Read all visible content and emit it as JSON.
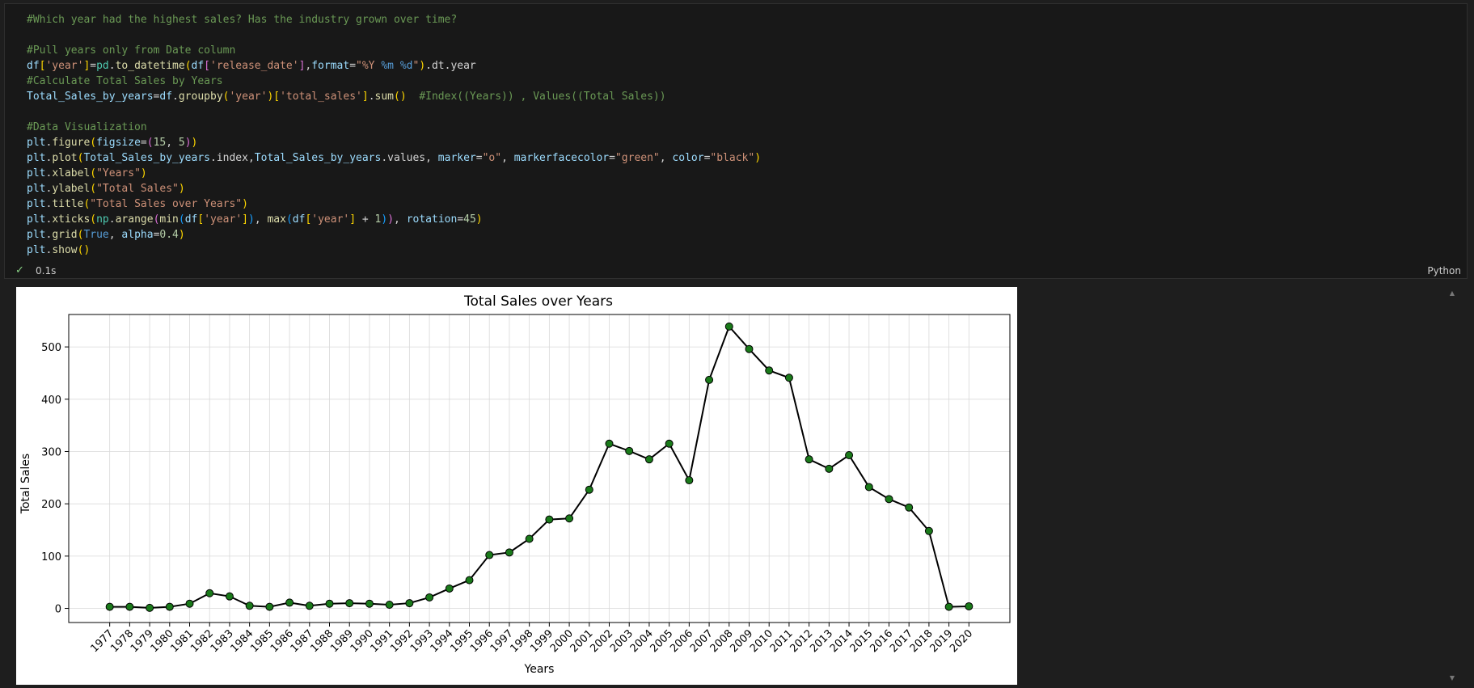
{
  "code_lines": [
    [
      [
        "c-com",
        "#Which year had the highest sales? Has the industry grown over time?"
      ]
    ],
    [],
    [
      [
        "c-com",
        "#Pull years only from Date column"
      ]
    ],
    [
      [
        "c-var",
        "df"
      ],
      [
        "c-br1",
        "["
      ],
      [
        "c-str",
        "'year'"
      ],
      [
        "c-br1",
        "]"
      ],
      [
        "",
        "="
      ],
      [
        "c-mod",
        "pd"
      ],
      [
        "",
        ".",
        ""
      ],
      [
        "c-fn",
        "to_datetime"
      ],
      [
        "c-br1",
        "("
      ],
      [
        "c-var",
        "df"
      ],
      [
        "c-br2",
        "["
      ],
      [
        "c-str",
        "'release_date'"
      ],
      [
        "c-br2",
        "]"
      ],
      [
        "",
        ","
      ],
      [
        "c-var",
        "format"
      ],
      [
        "",
        "="
      ],
      [
        "c-str",
        "\"%Y "
      ],
      [
        "c-kw",
        "%m"
      ],
      [
        "c-str",
        " "
      ],
      [
        "c-kw",
        "%d"
      ],
      [
        "c-str",
        "\""
      ],
      [
        "c-br1",
        ")"
      ],
      [
        "",
        ".dt.year"
      ]
    ],
    [
      [
        "c-com",
        "#Calculate Total Sales by Years"
      ]
    ],
    [
      [
        "c-var",
        "Total_Sales_by_years"
      ],
      [
        "",
        "="
      ],
      [
        "c-var",
        "df"
      ],
      [
        "",
        ".",
        ""
      ],
      [
        "c-fn",
        "groupby"
      ],
      [
        "c-br1",
        "("
      ],
      [
        "c-str",
        "'year'"
      ],
      [
        "c-br1",
        ")"
      ],
      [
        "c-br1",
        "["
      ],
      [
        "c-str",
        "'total_sales'"
      ],
      [
        "c-br1",
        "]"
      ],
      [
        "",
        ".",
        ""
      ],
      [
        "c-fn",
        "sum"
      ],
      [
        "c-br1",
        "()"
      ],
      [
        "",
        "  "
      ],
      [
        "c-com",
        "#Index((Years)) , Values((Total Sales))"
      ]
    ],
    [],
    [
      [
        "c-com",
        "#Data Visualization"
      ]
    ],
    [
      [
        "c-var",
        "plt"
      ],
      [
        "",
        ".",
        ""
      ],
      [
        "c-fn",
        "figure"
      ],
      [
        "c-br1",
        "("
      ],
      [
        "c-var",
        "figsize"
      ],
      [
        "",
        "="
      ],
      [
        "c-br2",
        "("
      ],
      [
        "c-num",
        "15"
      ],
      [
        "",
        ", "
      ],
      [
        "c-num",
        "5"
      ],
      [
        "c-br2",
        ")"
      ],
      [
        "c-br1",
        ")"
      ]
    ],
    [
      [
        "c-var",
        "plt"
      ],
      [
        "",
        ".",
        ""
      ],
      [
        "c-fn",
        "plot"
      ],
      [
        "c-br1",
        "("
      ],
      [
        "c-var",
        "Total_Sales_by_years"
      ],
      [
        "",
        ".index,"
      ],
      [
        "c-var",
        "Total_Sales_by_years"
      ],
      [
        "",
        ".values, "
      ],
      [
        "c-var",
        "marker"
      ],
      [
        "",
        "="
      ],
      [
        "c-str",
        "\"o\""
      ],
      [
        "",
        ", "
      ],
      [
        "c-var",
        "markerfacecolor"
      ],
      [
        "",
        "="
      ],
      [
        "c-str",
        "\"green\""
      ],
      [
        "",
        ", "
      ],
      [
        "c-var",
        "color"
      ],
      [
        "",
        "="
      ],
      [
        "c-str",
        "\"black\""
      ],
      [
        "c-br1",
        ")"
      ]
    ],
    [
      [
        "c-var",
        "plt"
      ],
      [
        "",
        ".",
        ""
      ],
      [
        "c-fn",
        "xlabel"
      ],
      [
        "c-br1",
        "("
      ],
      [
        "c-str",
        "\"Years\""
      ],
      [
        "c-br1",
        ")"
      ]
    ],
    [
      [
        "c-var",
        "plt"
      ],
      [
        "",
        ".",
        ""
      ],
      [
        "c-fn",
        "ylabel"
      ],
      [
        "c-br1",
        "("
      ],
      [
        "c-str",
        "\"Total Sales\""
      ],
      [
        "c-br1",
        ")"
      ]
    ],
    [
      [
        "c-var",
        "plt"
      ],
      [
        "",
        ".",
        ""
      ],
      [
        "c-fn",
        "title"
      ],
      [
        "c-br1",
        "("
      ],
      [
        "c-str",
        "\"Total Sales over Years\""
      ],
      [
        "c-br1",
        ")"
      ]
    ],
    [
      [
        "c-var",
        "plt"
      ],
      [
        "",
        ".",
        ""
      ],
      [
        "c-fn",
        "xticks"
      ],
      [
        "c-br1",
        "("
      ],
      [
        "c-mod",
        "np"
      ],
      [
        "",
        ".",
        ""
      ],
      [
        "c-fn",
        "arange"
      ],
      [
        "c-br2",
        "("
      ],
      [
        "c-fn",
        "min"
      ],
      [
        "c-br3",
        "("
      ],
      [
        "c-var",
        "df"
      ],
      [
        "c-br1",
        "["
      ],
      [
        "c-str",
        "'year'"
      ],
      [
        "c-br1",
        "]"
      ],
      [
        "c-br3",
        ")"
      ],
      [
        "",
        ", "
      ],
      [
        "c-fn",
        "max"
      ],
      [
        "c-br3",
        "("
      ],
      [
        "c-var",
        "df"
      ],
      [
        "c-br1",
        "["
      ],
      [
        "c-str",
        "'year'"
      ],
      [
        "c-br1",
        "]"
      ],
      [
        "",
        " + "
      ],
      [
        "c-num",
        "1"
      ],
      [
        "c-br3",
        ")"
      ],
      [
        "c-br2",
        ")"
      ],
      [
        "",
        ", "
      ],
      [
        "c-var",
        "rotation"
      ],
      [
        "",
        "="
      ],
      [
        "c-num",
        "45"
      ],
      [
        "c-br1",
        ")"
      ]
    ],
    [
      [
        "c-var",
        "plt"
      ],
      [
        "",
        ".",
        ""
      ],
      [
        "c-fn",
        "grid"
      ],
      [
        "c-br1",
        "("
      ],
      [
        "c-kw",
        "True"
      ],
      [
        "",
        ", "
      ],
      [
        "c-var",
        "alpha"
      ],
      [
        "",
        "="
      ],
      [
        "c-num",
        "0.4"
      ],
      [
        "c-br1",
        ")"
      ]
    ],
    [
      [
        "c-var",
        "plt"
      ],
      [
        "",
        ".",
        ""
      ],
      [
        "c-fn",
        "show"
      ],
      [
        "c-br1",
        "()"
      ]
    ]
  ],
  "status": {
    "check_icon": "✓",
    "exec_time": "0.1s",
    "language": "Python"
  },
  "scroll": {
    "up": "▲",
    "down": "▼"
  },
  "chart_data": {
    "type": "line",
    "title": "Total Sales over Years",
    "xlabel": "Years",
    "ylabel": "Total Sales",
    "marker": "o",
    "markerfacecolor": "#1a7a1a",
    "line_color": "#000000",
    "grid": true,
    "ylim": [
      -27,
      562
    ],
    "yticks": [
      0,
      100,
      200,
      300,
      400,
      500
    ],
    "x": [
      1977,
      1978,
      1979,
      1980,
      1981,
      1982,
      1983,
      1984,
      1985,
      1986,
      1987,
      1988,
      1989,
      1990,
      1991,
      1992,
      1993,
      1994,
      1995,
      1996,
      1997,
      1998,
      1999,
      2000,
      2001,
      2002,
      2003,
      2004,
      2005,
      2006,
      2007,
      2008,
      2009,
      2010,
      2011,
      2012,
      2013,
      2014,
      2015,
      2016,
      2017,
      2018,
      2019,
      2020
    ],
    "values": [
      3,
      3,
      1,
      3,
      9,
      29,
      23,
      5,
      3,
      11,
      5,
      9,
      10,
      9,
      7,
      10,
      21,
      38,
      54,
      102,
      107,
      133,
      170,
      172,
      227,
      315,
      301,
      285,
      315,
      245,
      437,
      539,
      496,
      455,
      441,
      285,
      267,
      293,
      232,
      209,
      193,
      148,
      3,
      4
    ]
  }
}
